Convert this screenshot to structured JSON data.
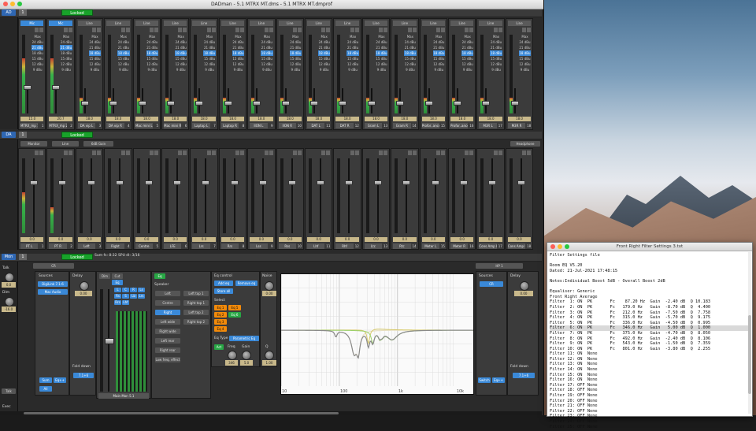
{
  "window": {
    "title": "DADman - 5.1 MTRX MT.dms - 5.1 MTRX MT.dmprof"
  },
  "sections": {
    "ad": {
      "tag": "AD",
      "num": "1",
      "lock": "Locked"
    },
    "da": {
      "tag": "DA",
      "num": "1",
      "lock": "Locked",
      "tabs": [
        "Monitor",
        "Line",
        "6dB Gain"
      ],
      "right_tab": "Headphone"
    },
    "mon": {
      "tag": "Mon",
      "num": "1",
      "lock": "Locked",
      "label": "CR",
      "right_label": "HP 1"
    },
    "bottom_tag": "Exec"
  },
  "ad_gain_steps": [
    "Max",
    "24 dBu",
    "21 dBu",
    "18 dBu",
    "15 dBu",
    "12 dBu",
    "9 dBu"
  ],
  "ad_channels": [
    {
      "hdr": "Mic",
      "blue": true,
      "sel": 2,
      "val": "15.0",
      "name": "MTRX_mp 1",
      "num": "1"
    },
    {
      "hdr": "Mic",
      "blue": true,
      "sel": 2,
      "val": "20.7",
      "name": "MTRX_mp 2",
      "num": "2"
    },
    {
      "hdr": "Line",
      "blue": false,
      "sel": 3,
      "val": "18.0",
      "name": "DA vip L",
      "num": "3"
    },
    {
      "hdr": "Line",
      "blue": false,
      "sel": 3,
      "val": "18.0",
      "name": "DA vip R",
      "num": "4"
    },
    {
      "hdr": "Line",
      "blue": false,
      "sel": 3,
      "val": "18.0",
      "name": "Mac mini L",
      "num": "5"
    },
    {
      "hdr": "Line",
      "blue": false,
      "sel": 3,
      "val": "18.0",
      "name": "Mac mini R",
      "num": "6"
    },
    {
      "hdr": "Line",
      "blue": false,
      "sel": 3,
      "val": "18.0",
      "name": "Laptop L",
      "num": "7"
    },
    {
      "hdr": "Line",
      "blue": false,
      "sel": 3,
      "val": "18.0",
      "name": "Laptop R",
      "num": "8"
    },
    {
      "hdr": "Line",
      "blue": false,
      "sel": 3,
      "val": "18.0",
      "name": "IION L",
      "num": "9"
    },
    {
      "hdr": "Line",
      "blue": false,
      "sel": 3,
      "val": "18.0",
      "name": "IION R",
      "num": "10"
    },
    {
      "hdr": "Line",
      "blue": false,
      "sel": 3,
      "val": "18.0",
      "name": "DAT L",
      "num": "11"
    },
    {
      "hdr": "Line",
      "blue": false,
      "sel": 3,
      "val": "18.0",
      "name": "DAT R",
      "num": "12"
    },
    {
      "hdr": "Line",
      "blue": false,
      "sel": 3,
      "val": "18.0",
      "name": "Gram L",
      "num": "13"
    },
    {
      "hdr": "Line",
      "blue": false,
      "sel": 3,
      "val": "18.0",
      "name": "Gram R",
      "num": "14"
    },
    {
      "hdr": "Line",
      "blue": false,
      "sel": 3,
      "val": "18.0",
      "name": "Profor..ance L",
      "num": "15"
    },
    {
      "hdr": "Line",
      "blue": false,
      "sel": 3,
      "val": "18.0",
      "name": "Profor..ance R",
      "num": "16"
    },
    {
      "hdr": "Line",
      "blue": false,
      "sel": 3,
      "val": "18.0",
      "name": "M3R L",
      "num": "17"
    },
    {
      "hdr": "Line",
      "blue": false,
      "sel": 3,
      "val": "18.0",
      "name": "M3R R",
      "num": "18"
    }
  ],
  "da_channels": [
    {
      "val": "0.0",
      "name": "PT L",
      "num": "1",
      "level": 0.55
    },
    {
      "val": "0.0",
      "name": "PT R",
      "num": "2",
      "level": 0.35
    },
    {
      "val": "0.0",
      "name": "Left",
      "num": "3",
      "level": 0
    },
    {
      "val": "0.0",
      "name": "Right",
      "num": "4",
      "level": 0
    },
    {
      "val": "0.0",
      "name": "Centre",
      "num": "5",
      "level": 0
    },
    {
      "val": "0.0",
      "name": "LFE",
      "num": "6",
      "level": 0
    },
    {
      "val": "0.0",
      "name": "Lrs",
      "num": "7",
      "level": 0
    },
    {
      "val": "0.0",
      "name": "Rrs",
      "num": "8",
      "level": 0
    },
    {
      "val": "0.0",
      "name": "Lss",
      "num": "9",
      "level": 0
    },
    {
      "val": "0.0",
      "name": "Rss",
      "num": "10",
      "level": 0
    },
    {
      "val": "0.0",
      "name": "Lhf",
      "num": "11",
      "level": 0
    },
    {
      "val": "0.0",
      "name": "Rhf",
      "num": "12",
      "level": 0
    },
    {
      "val": "0.0",
      "name": "Ltc",
      "num": "13",
      "level": 0
    },
    {
      "val": "0.0",
      "name": "Rtc",
      "num": "14",
      "level": 0
    },
    {
      "val": "0.0",
      "name": "Meter L",
      "num": "15",
      "level": 0
    },
    {
      "val": "0.0",
      "name": "Meter R",
      "num": "16",
      "level": 0
    },
    {
      "val": "0.0",
      "name": "Cons Amp L",
      "num": "17",
      "level": 0
    },
    {
      "val": "0.0",
      "name": "Cons Amp R",
      "num": "18",
      "level": 0
    }
  ],
  "mon": {
    "talk": "Talk",
    "talk_val": "0.0",
    "dim": "Dim",
    "dim_val": "-16.0",
    "sources_label": "Sources",
    "src1": "DigiLink 7.1-6",
    "src2": "Mac Audio",
    "delay_label": "Delay",
    "delay_val": "0.00",
    "fold_label": "Fold down",
    "fold_val": "7.1+6",
    "sum": "Sum",
    "eq_plus": "Eq++",
    "all": "All",
    "talk_btn": "Talk",
    "dim_btn": "Dim",
    "cut_btn": "Cut",
    "eq_btn": "Eq",
    "speaker_label": "Speaker",
    "eq_select_label": "Eq",
    "bottom_name": "Main Mon 5.1",
    "mute_grid": [
      "L",
      "C",
      "R",
      "Ls",
      "Rs",
      "S",
      "Lb",
      "Lrs",
      "Rrs",
      "Lhf"
    ],
    "speakers": [
      "Left",
      "Centre",
      "Right",
      "Left wide",
      "Right wide",
      "Left rear",
      "Right rear",
      "Low freq. effect"
    ],
    "speakers_right": [
      "Left top 1",
      "Right top 1",
      "Left top 2",
      "Right top 2"
    ],
    "eq_control": "Eq control",
    "add_eq": "Add eq",
    "remove_eq": "Remove eq",
    "store_all": "Store all",
    "select_label": "Select",
    "eqs": [
      "Eq 1",
      "Eq 2",
      "Eq 3",
      "Eq 4",
      "Eq 5",
      "Eq 6"
    ],
    "eq_type_label": "Eq Type",
    "eq_type": "Parametric Eq",
    "on_btn": "Act",
    "freq_label": "Freq",
    "gain_label": "Gain",
    "q_label": "Q",
    "freq_val": "346",
    "gain_val": "5.0",
    "q_val": "1.00",
    "noise_label": "Noise",
    "noise_val": "0.00",
    "hp_sources": "Sources",
    "hp_src": "CR",
    "hp_delay": "Delay",
    "hp_delay_val": "0.00",
    "hp_fold": "Fold down",
    "hp_fold_val": "7.1+6",
    "hp_switch": "Switch",
    "hp_eq": "Eq++",
    "info1": "Sum fs: 8:32",
    "info2": "Sum wp: 38:28",
    "info3": "SPU dl: 3/16",
    "info4": "SPU wp: 0/16"
  },
  "graph_ticks": [
    "10",
    "100",
    "1k",
    "10k"
  ],
  "settings_file": {
    "title": "Front Right Filter Settings 3.txt",
    "lines": [
      "Filter Settings file",
      "",
      "Room EQ V5.20",
      "Dated: 21-Jul-2021 17:48:15",
      "",
      "Notes:Individual Boost 5dB - Overall Boost 2dB",
      "",
      "Equaliser: Generic",
      "Front Right Average",
      "Filter  1: ON  PK       Fc    87.20 Hz  Gain  -2.40 dB  Q 10.183",
      "Filter  2: ON  PK       Fc   179.0 Hz   Gain  -8.70 dB  Q  4.400",
      "Filter  3: ON  PK       Fc   212.0 Hz   Gain  -7.50 dB  Q  7.758",
      "Filter  4: ON  PK       Fc   315.0 Hz   Gain  -5.70 dB  Q  9.175",
      "Filter  5: ON  PK       Fc   336.0 Hz   Gain  -4.50 dB  Q  0.995",
      "Filter  6: ON  PK       Fc   346.0 Hz   Gain   5.00 dB  Q  1.000",
      "Filter  7: ON  PK       Fc   375.0 Hz   Gain  -4.70 dB  Q  8.050",
      "Filter  8: ON  PK       Fc   492.0 Hz   Gain  -2.40 dB  Q  8.106",
      "Filter  9: ON  PK       Fc   543.0 Hz   Gain  -1.50 dB  Q  7.359",
      "Filter 10: ON  PK       Fc   801.0 Hz   Gain  -3.80 dB  Q  2.255",
      "Filter 11: ON  None",
      "Filter 12: ON  None",
      "Filter 13: ON  None",
      "Filter 14: ON  None",
      "Filter 15: ON  None",
      "Filter 16: ON  None",
      "Filter 17: OFF None",
      "Filter 18: OFF None",
      "Filter 19: OFF None",
      "Filter 20: OFF None",
      "Filter 21: OFF None",
      "Filter 22: OFF None",
      "Filter 23: OFF None",
      "Filter 24: OFF None",
      "Filter 25: OFF None"
    ],
    "highlight_index": 14
  }
}
